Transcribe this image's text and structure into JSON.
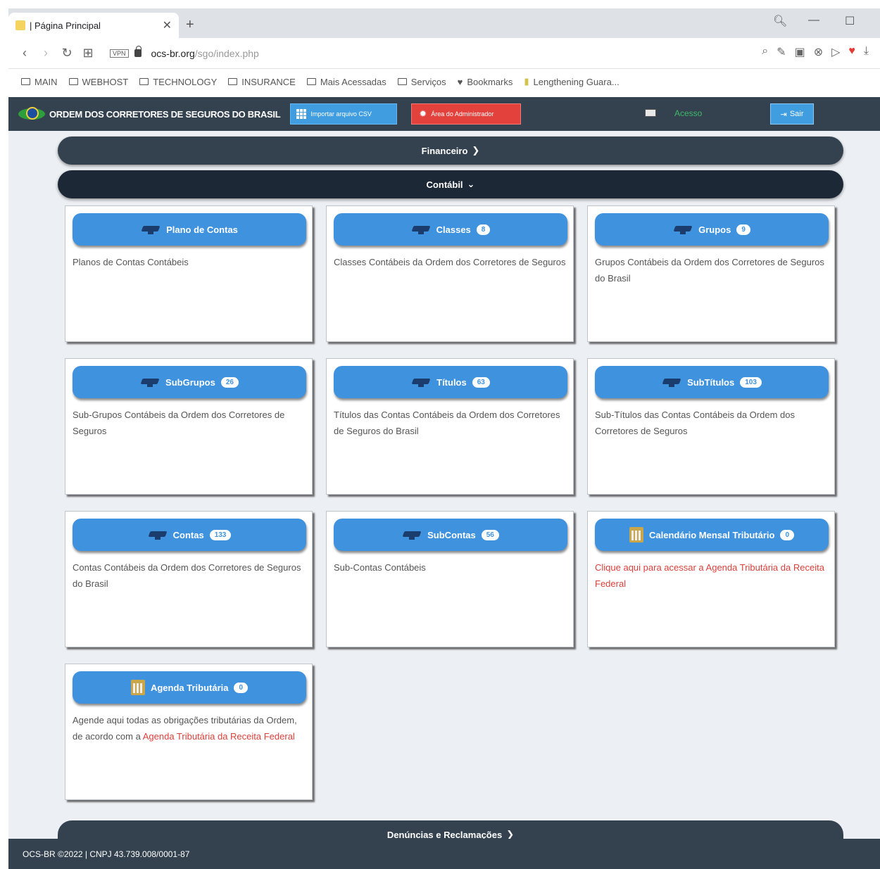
{
  "browser": {
    "tab_title": "| Página Principal",
    "tab_close": "✕",
    "new_tab": "+",
    "url_host": "ocs-br.org",
    "url_path": "/sgo/index.php",
    "vpn_label": "VPN",
    "bookmarks": [
      {
        "label": "MAIN",
        "icon": "folder-icon"
      },
      {
        "label": "WEBHOST",
        "icon": "folder-icon"
      },
      {
        "label": "TECHNOLOGY",
        "icon": "folder-icon"
      },
      {
        "label": "INSURANCE",
        "icon": "folder-icon"
      },
      {
        "label": "Mais Acessadas",
        "icon": "folder-icon"
      },
      {
        "label": "Serviços",
        "icon": "folder-icon"
      },
      {
        "label": "Bookmarks",
        "icon": "heart-icon"
      },
      {
        "label": "Lengthening Guara...",
        "icon": "page-icon"
      }
    ]
  },
  "appbar": {
    "brand": "ORDEM DOS CORRETORES DE SEGUROS DO BRASIL",
    "csv_button": "Importar arquivo CSV",
    "admin_button": "Área do Administrador",
    "acesso": "Acesso",
    "sair_button": "Sair"
  },
  "sections": {
    "financeiro": "Financeiro",
    "contabil": "Contábil",
    "denuncias": "Denúncias e Reclamações"
  },
  "cards": [
    {
      "title": "Plano de Contas",
      "badge": "",
      "icon": "graduation-cap-icon",
      "desc": "Planos de Contas Contábeis"
    },
    {
      "title": "Classes",
      "badge": "8",
      "icon": "graduation-cap-icon",
      "desc": "Classes Contábeis da Ordem dos Corretores de Seguros"
    },
    {
      "title": "Grupos",
      "badge": "9",
      "icon": "graduation-cap-icon",
      "desc": "Grupos Contábeis da Ordem dos Corretores de Seguros do Brasil"
    },
    {
      "title": "SubGrupos",
      "badge": "26",
      "icon": "graduation-cap-icon",
      "desc": "Sub-Grupos Contábeis da Ordem dos Corretores de Seguros"
    },
    {
      "title": "Títulos",
      "badge": "63",
      "icon": "graduation-cap-icon",
      "desc": "Títulos das Contas Contábeis da Ordem dos Corretores de Seguros do Brasil"
    },
    {
      "title": "SubTítulos",
      "badge": "103",
      "icon": "graduation-cap-icon",
      "desc": "Sub-Títulos das Contas Contábeis da Ordem dos Corretores de Seguros"
    },
    {
      "title": "Contas",
      "badge": "133",
      "icon": "graduation-cap-icon",
      "desc": "Contas Contábeis da Ordem dos Corretores de Seguros do Brasil"
    },
    {
      "title": "SubContas",
      "badge": "56",
      "icon": "graduation-cap-icon",
      "desc": "Sub-Contas Contábeis"
    },
    {
      "title": "Calendário Mensal Tributário",
      "badge": "0",
      "icon": "building-icon",
      "desc": "Clique aqui para acessar a Agenda Tributária da Receita Federal"
    },
    {
      "title": "Agenda Tributária",
      "badge": "0",
      "icon": "building-icon",
      "desc_prefix": "Agende aqui todas as obrigações tributárias da Ordem, de acordo com a ",
      "desc_link": "Agenda Tributária da Receita Federal"
    }
  ],
  "footer": {
    "text": "OCS-BR ©2022 | CNPJ 43.739.008/0001-87"
  },
  "colors": {
    "navbar": "#344250",
    "accent_blue": "#3f92dd",
    "admin_red": "#e3413c",
    "link_red": "#d9413c"
  }
}
